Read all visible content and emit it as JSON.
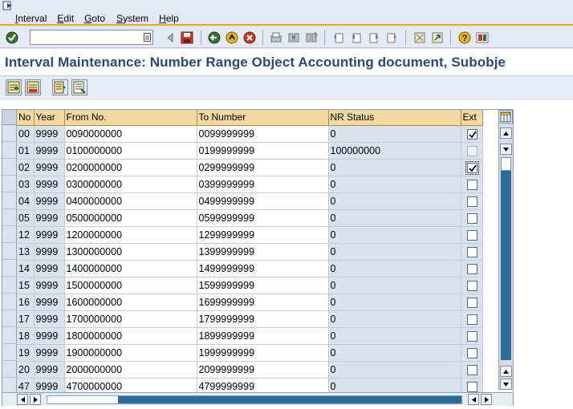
{
  "menu": [
    {
      "label": "Interval",
      "hotkey": "I",
      "rest": "nterval"
    },
    {
      "label": "Edit",
      "hotkey": "E",
      "rest": "dit"
    },
    {
      "label": "Goto",
      "hotkey": "G",
      "rest": "oto"
    },
    {
      "label": "System",
      "hotkey": "S",
      "rest": "ystem"
    },
    {
      "label": "Help",
      "hotkey": "H",
      "rest": "elp"
    }
  ],
  "command_field": {
    "value": "",
    "placeholder": ""
  },
  "title": "Interval Maintenance: Number Range Object Accounting document, Subobje",
  "table": {
    "columns": [
      "No",
      "Year",
      "From No.",
      "To Number",
      "NR Status",
      "Ext"
    ],
    "rows": [
      {
        "no": "00",
        "year": "9999",
        "from": "0090000000",
        "to": "0099999999",
        "status": "0",
        "ext": "checked"
      },
      {
        "no": "01",
        "year": "9999",
        "from": "0100000000",
        "to": "0199999999",
        "status": "100000000",
        "ext": "disabled"
      },
      {
        "no": "02",
        "year": "9999",
        "from": "0200000000",
        "to": "0299999999",
        "status": "0",
        "ext": "checked-focus"
      },
      {
        "no": "03",
        "year": "9999",
        "from": "0300000000",
        "to": "0399999999",
        "status": "0",
        "ext": "unchecked"
      },
      {
        "no": "04",
        "year": "9999",
        "from": "0400000000",
        "to": "0499999999",
        "status": "0",
        "ext": "unchecked"
      },
      {
        "no": "05",
        "year": "9999",
        "from": "0500000000",
        "to": "0599999999",
        "status": "0",
        "ext": "unchecked"
      },
      {
        "no": "12",
        "year": "9999",
        "from": "1200000000",
        "to": "1299999999",
        "status": "0",
        "ext": "unchecked"
      },
      {
        "no": "13",
        "year": "9999",
        "from": "1300000000",
        "to": "1399999999",
        "status": "0",
        "ext": "unchecked"
      },
      {
        "no": "14",
        "year": "9999",
        "from": "1400000000",
        "to": "1499999999",
        "status": "0",
        "ext": "unchecked"
      },
      {
        "no": "15",
        "year": "9999",
        "from": "1500000000",
        "to": "1599999999",
        "status": "0",
        "ext": "unchecked"
      },
      {
        "no": "16",
        "year": "9999",
        "from": "1600000000",
        "to": "1699999999",
        "status": "0",
        "ext": "unchecked"
      },
      {
        "no": "17",
        "year": "9999",
        "from": "1700000000",
        "to": "1799999999",
        "status": "0",
        "ext": "unchecked"
      },
      {
        "no": "18",
        "year": "9999",
        "from": "1800000000",
        "to": "1899999999",
        "status": "0",
        "ext": "unchecked"
      },
      {
        "no": "19",
        "year": "9999",
        "from": "1900000000",
        "to": "1999999999",
        "status": "0",
        "ext": "unchecked"
      },
      {
        "no": "20",
        "year": "9999",
        "from": "2000000000",
        "to": "2099999999",
        "status": "0",
        "ext": "unchecked"
      },
      {
        "no": "47",
        "year": "9999",
        "from": "4700000000",
        "to": "4799999999",
        "status": "0",
        "ext": "unchecked"
      }
    ]
  },
  "colors": {
    "title": "#2a4a74",
    "header_bg": "#f3d9a1",
    "accent_line": "#e8a33a",
    "scroll_thumb": "#2c6d97"
  },
  "toolbar_icons": [
    "enter-icon",
    "back-icon",
    "exit-icon",
    "cancel-icon",
    "print-icon",
    "find-icon",
    "find-next-icon",
    "first-page-icon",
    "previous-page-icon",
    "next-page-icon",
    "last-page-icon",
    "create-session-icon",
    "shortcut-icon",
    "help-icon",
    "customize-layout-icon"
  ],
  "app_toolbar_icons": [
    "insert-interval-icon",
    "delete-interval-icon",
    "change-status-icon",
    "overview-icon"
  ]
}
